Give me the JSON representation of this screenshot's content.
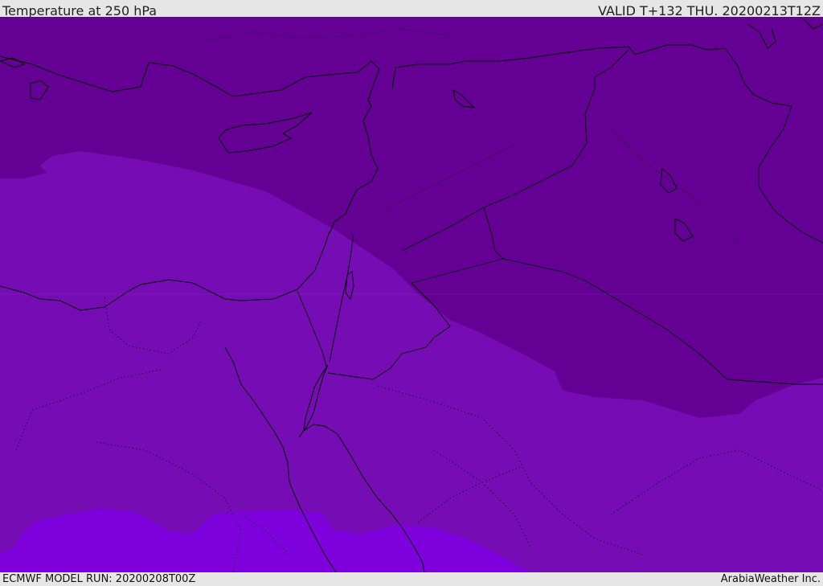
{
  "header": {
    "title": "Temperature at 250 hPa",
    "valid_time": "VALID T+132 THU. 20200213T12Z"
  },
  "footer": {
    "model_run": "ECMWF MODEL RUN: 20200208T00Z",
    "credit": "ArabiaWeather Inc."
  },
  "colors": {
    "band_cold": "#650095",
    "band_mid": "#760db4",
    "band_warm": "#7d00dd",
    "coastline": "#000000",
    "frame": "#e6e6e6"
  }
}
